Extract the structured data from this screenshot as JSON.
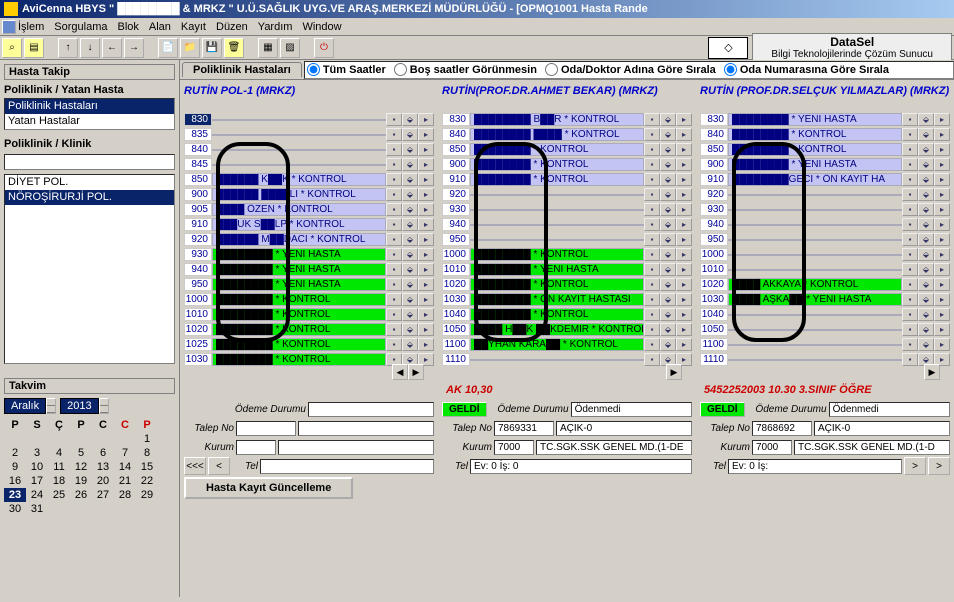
{
  "title": "AviCenna HBYS \"  ████████  & MRKZ \" U.Ü.SAĞLIK UYG.VE ARAŞ.MERKEZİ MÜDÜRLÜĞÜ - [OPMQ1001 Hasta Rande",
  "menu": [
    "İşlem",
    "Sorgulama",
    "Blok",
    "Alan",
    "Kayıt",
    "Düzen",
    "Yardım",
    "Window"
  ],
  "brand": {
    "name": "DataSel",
    "slogan": "Bilgi Teknolojilerinde Çözüm Sunucu"
  },
  "sidebar": {
    "hasta_takip": "Hasta Takip",
    "pk_yatan": "Poliklinik / Yatan Hasta",
    "list1": [
      "Poliklinik Hastaları",
      "Yatan Hastalar"
    ],
    "pk_klinik": "Poliklinik / Klinik",
    "klinik_list": [
      "DİYET POL.",
      "NÖROŞİRURJİ POL."
    ]
  },
  "takvim": {
    "title": "Takvim",
    "month": "Aralık",
    "year": "2013",
    "days": [
      "P",
      "S",
      "Ç",
      "P",
      "C",
      "C",
      "P"
    ],
    "rows": [
      [
        "",
        "",
        "",
        "",
        "",
        "",
        "1"
      ],
      [
        "2",
        "3",
        "4",
        "5",
        "6",
        "7",
        "8"
      ],
      [
        "9",
        "10",
        "11",
        "12",
        "13",
        "14",
        "15"
      ],
      [
        "16",
        "17",
        "18",
        "19",
        "20",
        "21",
        "22"
      ],
      [
        "23",
        "24",
        "25",
        "26",
        "27",
        "28",
        "29"
      ],
      [
        "30",
        "31",
        "",
        "",
        "",
        "",
        ""
      ]
    ],
    "today": "23"
  },
  "tab": "Poliklinik Hastaları",
  "radios": [
    "Tüm Saatler",
    "Boş saatler Görünmesin",
    "Oda/Doktor Adına Göre Sırala",
    "Oda Numarasına Göre Sırala"
  ],
  "cols": [
    {
      "title": "RUTİN POL-1 (MRKZ)",
      "slots": [
        {
          "t": "830",
          "n": "",
          "c": "white",
          "sel": true
        },
        {
          "t": "835",
          "n": "",
          "c": "blue"
        },
        {
          "t": "840",
          "n": "",
          "c": "blue"
        },
        {
          "t": "845",
          "n": "",
          "c": "blue"
        },
        {
          "t": "850",
          "n": "██████ K██K * KONTROL",
          "c": "blue"
        },
        {
          "t": "900",
          "n": "██████ ████LI * KONTROL",
          "c": "blue"
        },
        {
          "t": "905",
          "n": "████ ÖZEN * KONTROL",
          "c": "blue"
        },
        {
          "t": "910",
          "n": "███UK S██LP * KONTROL",
          "c": "blue"
        },
        {
          "t": "920",
          "n": "██████ M██DACI * KONTROL",
          "c": "blue"
        },
        {
          "t": "930",
          "n": "████████ * YENİ HASTA",
          "c": "green"
        },
        {
          "t": "940",
          "n": "████████ * YENİ HASTA",
          "c": "green"
        },
        {
          "t": "950",
          "n": "████████ * YENİ HASTA",
          "c": "green"
        },
        {
          "t": "1000",
          "n": "████████ * KONTROL",
          "c": "green"
        },
        {
          "t": "1010",
          "n": "████████ * KONTROL",
          "c": "green"
        },
        {
          "t": "1020",
          "n": "████████ * KONTROL",
          "c": "green"
        },
        {
          "t": "1025",
          "n": "████████ * KONTROL",
          "c": "green"
        },
        {
          "t": "1030",
          "n": "████████ * KONTROL",
          "c": "green"
        }
      ],
      "info": "",
      "detail": {
        "geldi": "",
        "odeme_l": "Ödeme Durumu",
        "odeme_v": "",
        "talep_l": "Talep No",
        "talep_v": "",
        "acik": "",
        "kurum_l": "Kurum",
        "kurum_v": "",
        "kurum_n": "",
        "tel_l": "Tel",
        "tel_v": ""
      }
    },
    {
      "title": "RUTİN(PROF.DR.AHMET BEKAR) (MRKZ)",
      "slots": [
        {
          "t": "830",
          "n": "████████ B██R * KONTROL",
          "c": "blue"
        },
        {
          "t": "840",
          "n": "████████ ████ * KONTROL",
          "c": "blue"
        },
        {
          "t": "850",
          "n": "████████ * KONTROL",
          "c": "blue"
        },
        {
          "t": "900",
          "n": "████████ * KONTROL",
          "c": "blue"
        },
        {
          "t": "910",
          "n": "████████ * KONTROL",
          "c": "blue"
        },
        {
          "t": "920",
          "n": "",
          "c": "white"
        },
        {
          "t": "930",
          "n": "",
          "c": "white"
        },
        {
          "t": "940",
          "n": "",
          "c": "white"
        },
        {
          "t": "950",
          "n": "",
          "c": "white"
        },
        {
          "t": "1000",
          "n": "████████ * KONTROL",
          "c": "green"
        },
        {
          "t": "1010",
          "n": "████████ * YENİ HASTA",
          "c": "green"
        },
        {
          "t": "1020",
          "n": "████████ * KONTROL",
          "c": "green"
        },
        {
          "t": "1030",
          "n": "████████ * ÖN KAYIT HASTASI",
          "c": "green"
        },
        {
          "t": "1040",
          "n": "████████ * KONTROL",
          "c": "green"
        },
        {
          "t": "1050",
          "n": "████ H██K ██KDEMİR * KONTROL",
          "c": "green"
        },
        {
          "t": "1100",
          "n": "██YHAN KARA██ * KONTROL",
          "c": "green"
        },
        {
          "t": "1110",
          "n": "",
          "c": "white"
        }
      ],
      "info": "AK  10,30",
      "detail": {
        "geldi": "GELDİ",
        "odeme_l": "Ödeme Durumu",
        "odeme_v": "Ödenmedi",
        "talep_l": "Talep No",
        "talep_v": "7869331",
        "acik": "AÇIK-0",
        "kurum_l": "Kurum",
        "kurum_v": "7000",
        "kurum_n": "TC.SGK.SSK GENEL MD.(1-DE",
        "tel_l": "Tel",
        "tel_v": "Ev: 0 İş: 0"
      }
    },
    {
      "title": "RUTİN (PROF.DR.SELÇUK YILMAZLAR) (MRKZ)",
      "slots": [
        {
          "t": "830",
          "n": "████████ * YENİ HASTA",
          "c": "blue"
        },
        {
          "t": "840",
          "n": "████████ * KONTROL",
          "c": "blue"
        },
        {
          "t": "850",
          "n": "████████ * KONTROL",
          "c": "blue"
        },
        {
          "t": "900",
          "n": "████████ * YENİ HASTA",
          "c": "blue"
        },
        {
          "t": "910",
          "n": "████████GECİ * ÖN KAYIT HA",
          "c": "blue"
        },
        {
          "t": "920",
          "n": "",
          "c": "white"
        },
        {
          "t": "930",
          "n": "",
          "c": "white"
        },
        {
          "t": "940",
          "n": "",
          "c": "white"
        },
        {
          "t": "950",
          "n": "",
          "c": "white"
        },
        {
          "t": "1000",
          "n": "",
          "c": "white"
        },
        {
          "t": "1010",
          "n": "",
          "c": "white"
        },
        {
          "t": "1020",
          "n": "████ AKKAYA * KONTROL",
          "c": "green"
        },
        {
          "t": "1030",
          "n": "████ AŞKA██ * YENİ HASTA",
          "c": "green"
        },
        {
          "t": "1040",
          "n": "",
          "c": "white"
        },
        {
          "t": "1050",
          "n": "",
          "c": "white"
        },
        {
          "t": "1100",
          "n": "",
          "c": "white"
        },
        {
          "t": "1110",
          "n": "",
          "c": "white"
        }
      ],
      "info": "5452252003 10.30 3.SINIF ÖĞRE",
      "detail": {
        "geldi": "GELDİ",
        "odeme_l": "Ödeme Durumu",
        "odeme_v": "Ödenmedi",
        "talep_l": "Talep No",
        "talep_v": "7868692",
        "acik": "AÇIK-0",
        "kurum_l": "Kurum",
        "kurum_v": "7000",
        "kurum_n": "TC.SGK.SSK GENEL MD.(1-D",
        "tel_l": "Tel",
        "tel_v": "Ev: 0 İş:"
      }
    }
  ],
  "buttons": {
    "hasta_kayit": "Hasta Kayıt Güncelleme"
  }
}
